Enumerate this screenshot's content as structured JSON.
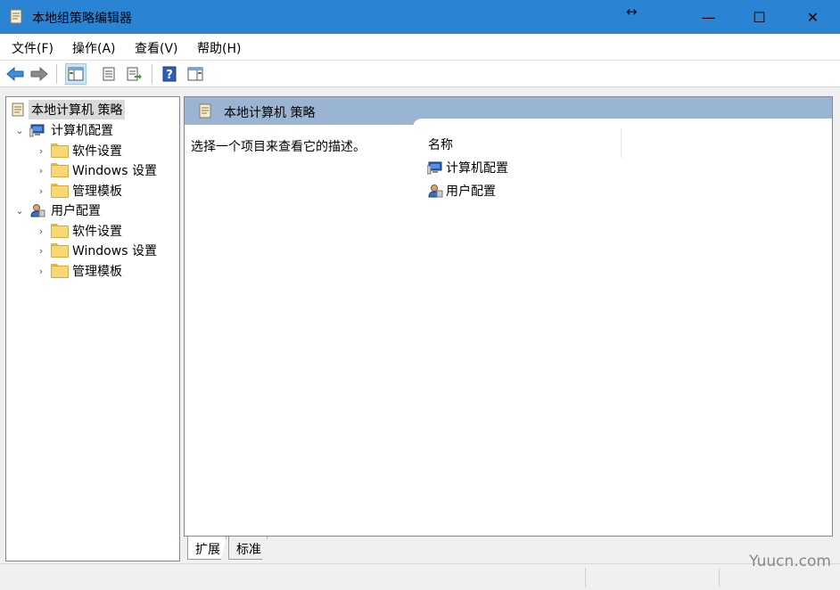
{
  "window": {
    "title": "本地组策略编辑器",
    "resize_glyph": "↔",
    "controls": {
      "minimize": "—",
      "maximize": "☐",
      "close": "✕"
    }
  },
  "menubar": {
    "items": [
      "文件(F)",
      "操作(A)",
      "查看(V)",
      "帮助(H)"
    ]
  },
  "toolbar": {
    "buttons": [
      "back-arrow-icon",
      "forward-arrow-icon",
      "show-hide-tree-icon",
      "properties-icon",
      "export-list-icon",
      "help-icon",
      "show-hide-action-pane-icon"
    ]
  },
  "tree": {
    "root": "本地计算机 策略",
    "computer": {
      "label": "计算机配置",
      "children": [
        "软件设置",
        "Windows 设置",
        "管理模板"
      ]
    },
    "user": {
      "label": "用户配置",
      "children": [
        "软件设置",
        "Windows 设置",
        "管理模板"
      ]
    }
  },
  "main": {
    "header_title": "本地计算机 策略",
    "description": "选择一个项目来查看它的描述。",
    "column_name": "名称",
    "items": [
      "计算机配置",
      "用户配置"
    ]
  },
  "tabs": [
    "扩展",
    "标准"
  ],
  "watermark": "Yuucn.com",
  "colors": {
    "titlebar": "#2b83d3",
    "pane_header": "#9ab4d3",
    "selection": "#d9d9d9"
  }
}
